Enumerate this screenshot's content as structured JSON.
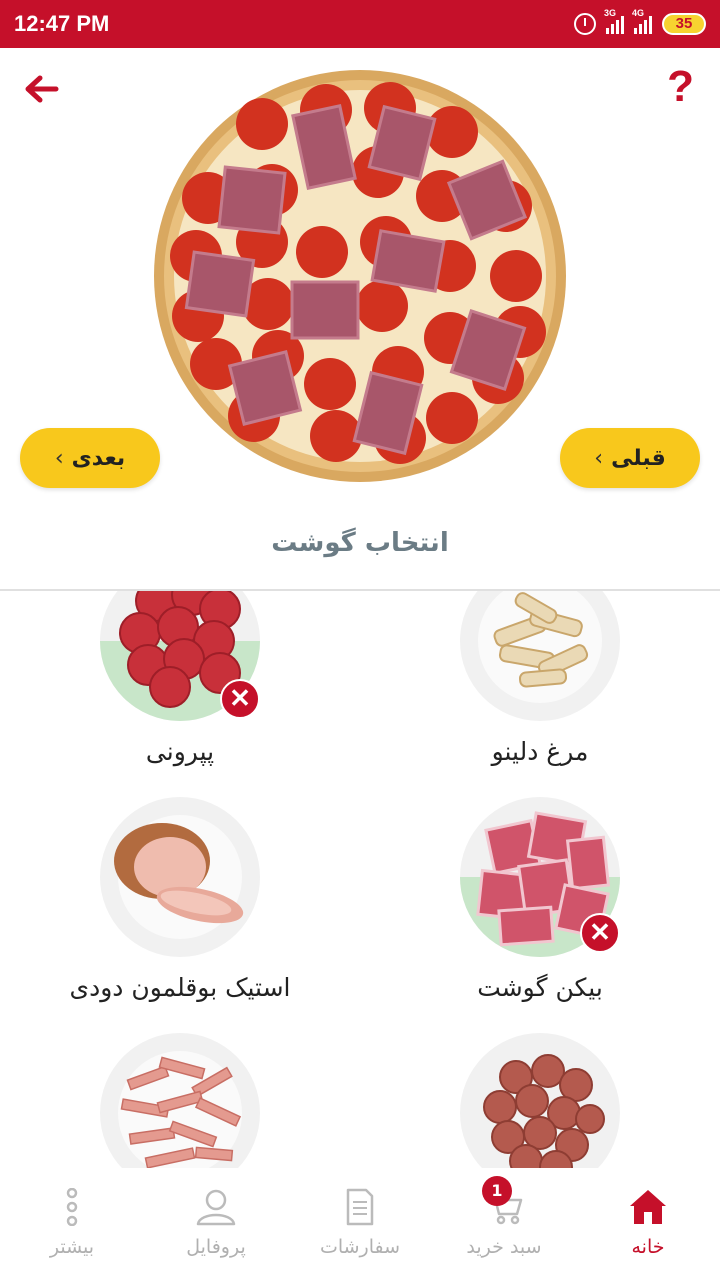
{
  "status_bar": {
    "time": "12:47 PM",
    "signal_1_label": "3G",
    "signal_2_label": "4G",
    "battery": "35"
  },
  "header": {
    "help_label": "?"
  },
  "nav_buttons": {
    "next_label": "بعدی",
    "prev_label": "قبلی"
  },
  "section_title": "انتخاب گوشت",
  "items": [
    {
      "label": "مرغ دلینو",
      "selected": false
    },
    {
      "label": "پپرونی",
      "selected": true
    },
    {
      "label": "بیکن گوشت",
      "selected": true
    },
    {
      "label": "استیک بوقلمون دودی",
      "selected": false
    },
    {
      "label": "",
      "selected": false
    },
    {
      "label": "",
      "selected": false
    }
  ],
  "remove_symbol": "✕",
  "bottom_nav": {
    "home": "خانه",
    "cart": "سبد خرید",
    "cart_count": "1",
    "orders": "سفارشات",
    "profile": "پروفایل",
    "more": "بیشتر"
  },
  "colors": {
    "brand": "#c5102a",
    "button_yellow": "#f8c81c",
    "selected_band": "#c8e6c9"
  }
}
